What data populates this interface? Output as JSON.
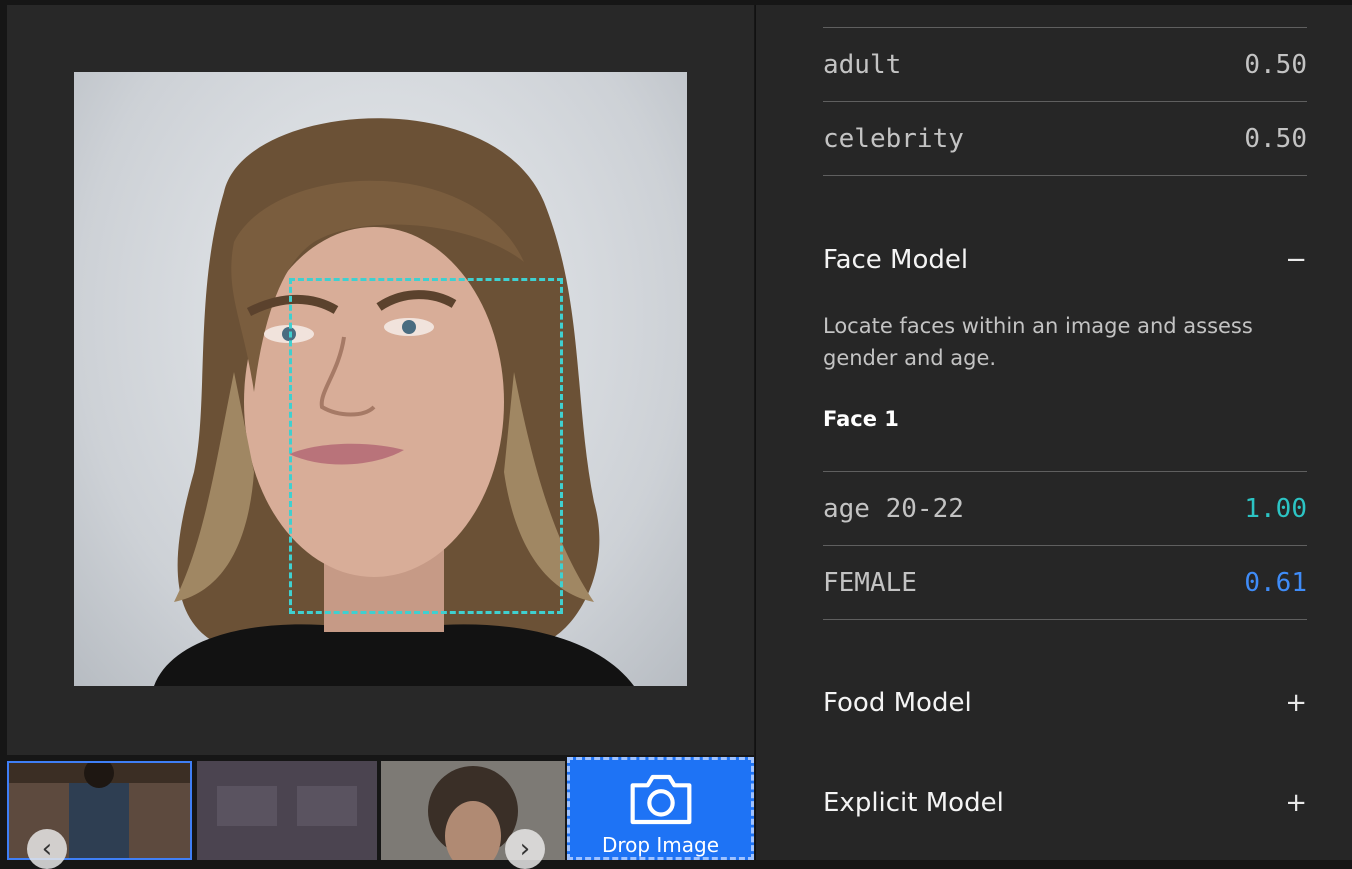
{
  "classifier_rows": [
    {
      "name": "adult",
      "score": "0.50"
    },
    {
      "name": "celebrity",
      "score": "0.50"
    }
  ],
  "face_model": {
    "title": "Face Model",
    "toggle": "−",
    "description": "Locate faces within an image and assess gender and age.",
    "face_label": "Face 1",
    "rows": [
      {
        "name": "age 20-22",
        "score": "1.00",
        "score_color": "#2cc4c4"
      },
      {
        "name": "FEMALE",
        "score": "0.61",
        "score_color": "#3f8cf8"
      }
    ]
  },
  "food_model": {
    "title": "Food Model",
    "toggle": "+"
  },
  "explicit_model": {
    "title": "Explicit Model",
    "toggle": "+"
  },
  "drop_tile": {
    "label": "Drop Image",
    "icon": "camera-icon"
  },
  "colors": {
    "accent": "#1e73f5",
    "face_box": "#3fd0d0",
    "age_score": "#2cc4c4",
    "gender_score": "#3f8cf8"
  }
}
